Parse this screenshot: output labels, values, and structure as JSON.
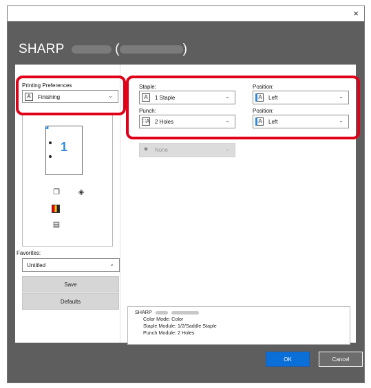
{
  "window": {
    "close_glyph": "×",
    "title_brand": "SHARP",
    "title_paren_open": "(",
    "title_paren_close": ")"
  },
  "left_panel": {
    "printing_preferences_label": "Printing Preferences",
    "printing_preferences_value": "Finishing",
    "preview_page_number": "1",
    "favorites_label": "Favorites:",
    "favorites_value": "Untitled",
    "save_label": "Save",
    "defaults_label": "Defaults"
  },
  "finishing": {
    "staple_label": "Staple:",
    "staple_value": "1 Staple",
    "staple_position_label": "Position:",
    "staple_position_value": "Left",
    "punch_label": "Punch:",
    "punch_value": "2 Holes",
    "punch_position_label": "Position:",
    "punch_position_value": "Left",
    "output_value": "None"
  },
  "info": {
    "printer_name": "SHARP",
    "color_mode": "Color Mode: Color",
    "staple_module": "Staple Module: 1/2/Saddle Staple",
    "punch_module": "Punch Module: 2 Holes"
  },
  "footer": {
    "ok_label": "OK",
    "cancel_label": "Cancel"
  },
  "colors": {
    "highlight": "#e00018",
    "accent_blue": "#0a6fd8",
    "header_gray": "#5e5e5e"
  },
  "icons": {
    "dropdown_chevron": "chevron-down-icon",
    "close": "close-icon"
  }
}
